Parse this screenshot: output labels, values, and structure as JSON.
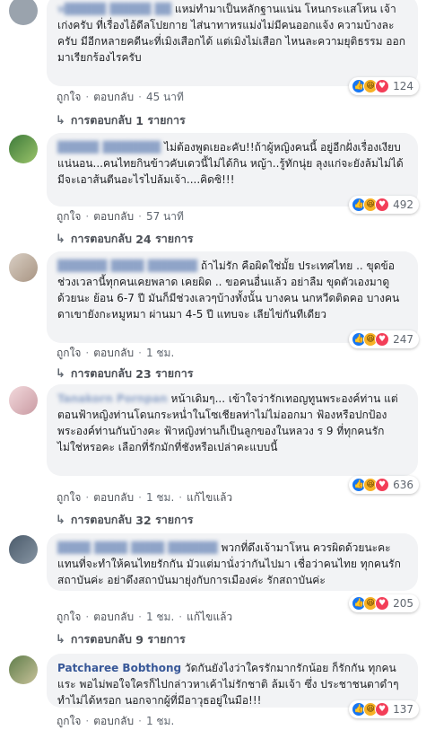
{
  "labels": {
    "like": "ถูกใจ",
    "reply": "ตอบกลับ",
    "edited": "แก้ไขแล้ว",
    "replies_prefix": "การตอบกลับ",
    "replies_suffix": "รายการ"
  },
  "comments": [
    {
      "author": "ห█████ █████ ██",
      "text": "แหม่ทำมาเป็นหลักฐานแน่น โหนกระแสโหน เจ้าเก่งครับ ที่เรื่องไอ้ดีลโปยกาย ไส่นาทาหรแม่งไม่มีคนออกแจ้ง ความบ้างละครับ มีอีกหลายคดีนะที่เมิงเสือกได้ แต่เมิงไม่เสือก ไหนละความยุติธรรม ออกมาเรียกร้องไรครับ",
      "time": "45 นาที",
      "reactions": "124",
      "replies": "1"
    },
    {
      "author": "█████ ███████ ",
      "text": "ไม่ต้องพูดเยอะคับ!!ถ้าผู้หญิงคนนี้ อยู่อีกฝั่งเรื่องเงียบแน่นอน...คนไทยกินข้าวคับเดวนี้ไม่ได้กิน หญ้า..รู้ทักนุ่ย ลุงแก่จะยังล้มไม่ได้มีจะเอาส้นตีนอะไรไปล้มเจ้า....คิดซิ!!!",
      "time": "57 นาที",
      "reactions": "492",
      "replies": "24"
    },
    {
      "author": "██████ ████ ██████",
      "text": "ถ้าไม่รัก คือผิดใช่มั้ย ประเทศไทย .. ขุดข้อ ช่วงเวลานี้ทุกคนเคยพลาด เคยผิด .. ขอคนอื่นแล้ว อย่าลืม ขุดตัวเองมาดูด้วยนะ ย้อน 6-7 ปี มันก็มีช่วงเลวๆบ้างทั้งนั้น บางคน นกหวีดติดคอ บางคน ดาเขายังกะหมูหมา ผ่านมา 4-5 ปี แทบจะ เลียไข่กันทีเดียว",
      "time": "1 ชม.",
      "reactions": "247",
      "replies": "23"
    },
    {
      "author": "Tanakorn Pornpan",
      "text": "หน้าเดิมๆ... เข้าใจว่ารักเทอญทูนพระองค์ท่าน แต่ตอนฟ้าหญิงท่านโดนกระหน่ำในโซเชียลท่าไม่ไม่ออกมา ฟ้องหรือปกป้องพระองค์ท่านกันบ้างคะ ฟ้าหญิงท่านก็เป็นลูกของในหลวง ร 9 ที่ทุกคนรักไม่ใช่หรอคะ เลือกที่รักมักที่ชังหรือเปล่าคะแบบนี้",
      "time": "1 ชม.",
      "edited": true,
      "reactions": "636",
      "replies": "32"
    },
    {
      "author": "████ ████ ████ ██████",
      "text": "พวกที่ดึงเจ้ามาโหน ควรผิดด้วยนะคะ แทนที่จะทำให้คนไทยรักกัน มัวแต่มานั่งว่ากันไปมา เชื่อว่าคนไทย ทุกคนรักสถาบันค่ะ อย่าดึงสถาบันมายุ่งกับการเมืองค่ะ รักสถาบันค่ะ",
      "time": "1 ชม.",
      "edited": true,
      "reactions": "205",
      "replies": "9"
    },
    {
      "author": "Patcharee Bobthong",
      "text": "วัดกันยังไงว่าใครรักมากรักน้อย ก็รักกัน ทุกคนแระ พอไม่พอใจใครก็ไปกล่าวหาเค้าไม่รักชาติ ล้มเจ้า ซึ่ง ประชาชนตาดำๆทำไม่ได้หรอก นอกจากผู้ที่มีอาวุธอยู่ในมือ!!!",
      "time": "1 ชม.",
      "reactions": "137"
    }
  ],
  "colors": {
    "link": "#385898",
    "bubble": "#f2f3f5",
    "like": "#1877f2",
    "haha": "#f7b125",
    "love": "#f33e58"
  }
}
